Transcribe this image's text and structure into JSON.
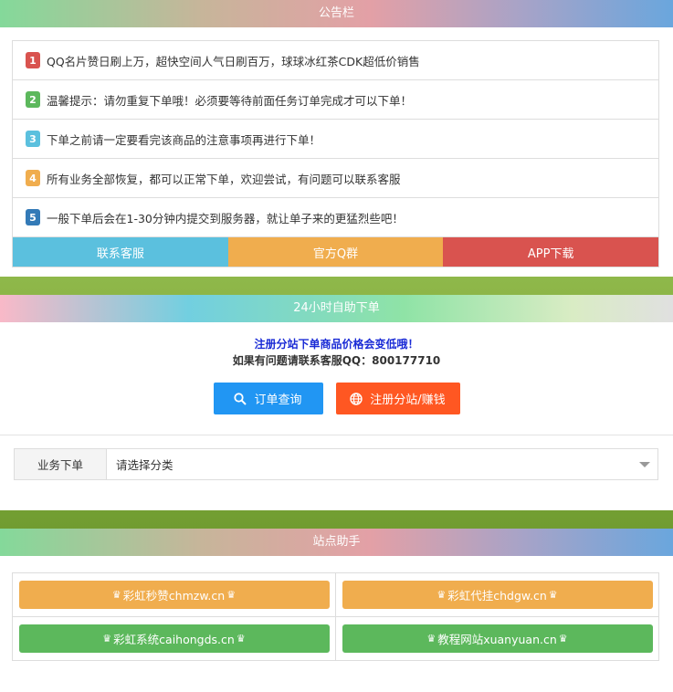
{
  "notice": {
    "title": "公告栏",
    "items": [
      {
        "num": "1",
        "text": "QQ名片赞日刷上万，超快空间人气日刷百万，球球冰红茶CDK超低价销售",
        "color": "#d9534f"
      },
      {
        "num": "2",
        "text": "温馨提示：请勿重复下单哦！必须要等待前面任务订单完成才可以下单！",
        "color": "#5cb85c"
      },
      {
        "num": "3",
        "text": "下单之前请一定要看完该商品的注意事项再进行下单！",
        "color": "#5bc0de"
      },
      {
        "num": "4",
        "text": "所有业务全部恢复，都可以正常下单，欢迎尝试，有问题可以联系客服",
        "color": "#f0ad4e"
      },
      {
        "num": "5",
        "text": "一般下单后会在1-30分钟内提交到服务器，就让单子来的更猛烈些吧！",
        "color": "#337ab7"
      }
    ],
    "buttons": [
      {
        "label": "联系客服",
        "color": "#5bc0de"
      },
      {
        "label": "官方Q群",
        "color": "#f0ad4e"
      },
      {
        "label": "APP下载",
        "color": "#d9534f"
      }
    ]
  },
  "order": {
    "title": "24小时自助下单",
    "line1": "注册分站下单商品价格会变低哦！",
    "line2": "如果有问题请联系客服QQ：800177710",
    "query_label": "订单查询",
    "register_label": "注册分站/赚钱",
    "query_color": "#2196f3",
    "register_color": "#ff5722",
    "category_label": "业务下单",
    "category_value": "请选择分类"
  },
  "helper": {
    "title": "站点助手",
    "crown": "♛",
    "links": [
      {
        "label": "彩虹秒赞chmzw.cn",
        "color": "#f0ad4e"
      },
      {
        "label": "彩虹代挂chdgw.cn",
        "color": "#f0ad4e"
      },
      {
        "label": "彩虹系统caihongds.cn",
        "color": "#5cb85c"
      },
      {
        "label": "教程网站xuanyuan.cn",
        "color": "#5cb85c"
      }
    ]
  }
}
